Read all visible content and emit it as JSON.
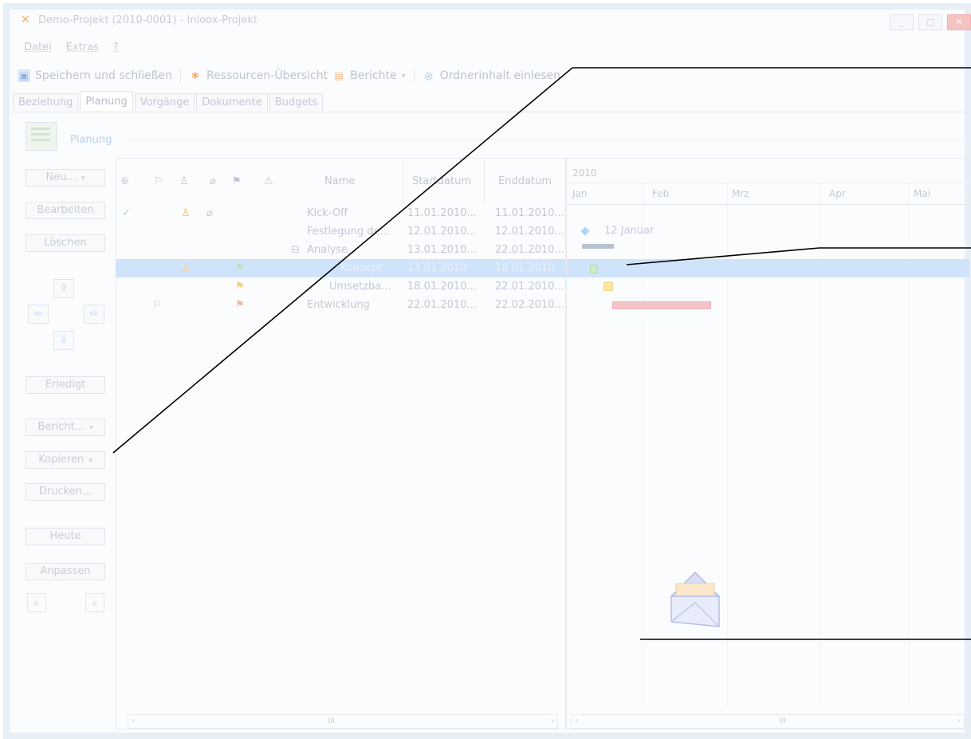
{
  "window": {
    "title": "Demo-Projekt (2010-0001) - Inloox-Projekt",
    "controls": [
      "_",
      "□",
      "✕"
    ]
  },
  "menu": [
    "Datei",
    "Extras",
    "?"
  ],
  "toolbar": {
    "save_close": "Speichern und schließen",
    "resources": "Ressourcen-Übersicht",
    "reports": "Berichte",
    "reports_arrow": "▾",
    "folder": "Ordnerinhalt einlesen"
  },
  "tabs": [
    "Beziehung",
    "Planung",
    "Vorgänge",
    "Dokumente",
    "Budgets"
  ],
  "section": {
    "title": "Planung"
  },
  "left_buttons": {
    "new": "Neu...",
    "edit": "Bearbeiten",
    "delete": "Löschen",
    "done": "Erledigt",
    "report": "Bericht...",
    "copy": "Kopieren",
    "print": "Drucken...",
    "today": "Heute",
    "adjust": "Anpassen"
  },
  "grid": {
    "columns": {
      "name": "Name",
      "start": "Startdatum",
      "end": "Enddatum"
    },
    "rows": [
      {
        "name": "Kick-Off",
        "start": "11.01.2010...",
        "end": "11.01.2010..."
      },
      {
        "name": "Festlegung de...",
        "start": "12.01.2010...",
        "end": "12.01.2010..."
      },
      {
        "name": "Analyse",
        "start": "13.01.2010...",
        "end": "22.01.2010...",
        "expander": "⊟"
      },
      {
        "name": "Konzept",
        "start": "13.01.2010",
        "end": "18.01.2010"
      },
      {
        "name": "Umsetzba...",
        "start": "18.01.2010...",
        "end": "22.01.2010..."
      },
      {
        "name": "Entwicklung",
        "start": "22.01.2010...",
        "end": "22.02.2010..."
      }
    ]
  },
  "gantt": {
    "year": "2010",
    "months": [
      "Jan",
      "Feb",
      "Mrz",
      "Apr",
      "Mai"
    ],
    "milestone_label": "12 Januar"
  },
  "scroll": {
    "thumb": "III",
    "left": "‹",
    "right": "›"
  },
  "colors": {
    "selection": "#cfe3fb",
    "bar_red": "#f6c4c8",
    "bar_yellow": "#fbe6a4",
    "bar_green": "#cfeac6"
  }
}
